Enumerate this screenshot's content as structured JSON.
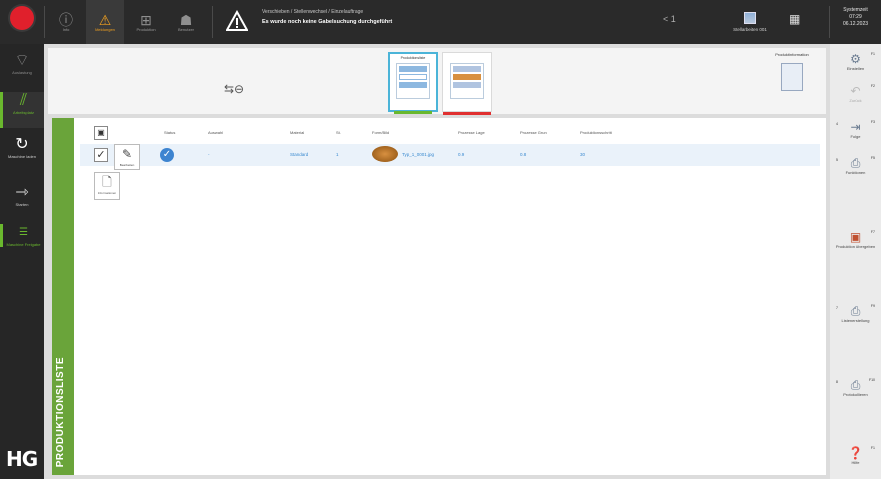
{
  "topbar": {
    "tabs": [
      {
        "icon": "info-icon",
        "label": "Info"
      },
      {
        "icon": "warning-icon",
        "label": "Meldungen"
      },
      {
        "icon": "chart-icon",
        "label": "Produktion"
      },
      {
        "icon": "person-icon",
        "label": "Benutzer"
      }
    ],
    "breadcrumb": "Verschieben / Stellenwechsel / Einzelauftrage",
    "message": "Es wurde noch keine Gabelsuchung durchgeführt",
    "nav_label": "< 1",
    "station_label": "Stellarbeiten 001",
    "clock": {
      "label": "Systemzeit",
      "time": "07:29",
      "date": "06.12.2023"
    }
  },
  "leftbar": {
    "items": [
      {
        "icon": "wifi-icon",
        "label": "Auslastung"
      },
      {
        "icon": "lines-icon",
        "label": "Arbeitsplatz"
      },
      {
        "icon": "refresh-icon",
        "label": "Maschine laden"
      },
      {
        "icon": "arrow-right-icon",
        "label": "Starten"
      },
      {
        "icon": "list-icon",
        "label": "Maschine Freigabe"
      }
    ],
    "logo": "HG"
  },
  "toolbar": {
    "view_prod_label": "Produktionsliste",
    "prod_info_label": "Produktinformation"
  },
  "list": {
    "title": "PRODUKTIONSLISTE",
    "columns": [
      "Status",
      "Auswahl",
      "Material",
      "St.",
      "Form/Bild",
      "Prozesse Lage",
      "Prozesse Grun",
      "Produktionsschritt"
    ],
    "row": {
      "auswahl": "-",
      "material": "Standard",
      "count": "1",
      "form": "Typ_1_0001.jpg",
      "lage": "0.9",
      "grun": "0.8",
      "schritt": "30"
    },
    "edit_label": "Bearbeiten",
    "doc_label": "Informationen"
  },
  "rightbar": {
    "items": [
      {
        "icon": "settings-icon",
        "label": "Einstellen",
        "key": "F1"
      },
      {
        "icon": "undo-icon",
        "label": "Zurück",
        "key": "F2"
      },
      {
        "icon": "arrow-icon",
        "label": "Folge",
        "key": "F3",
        "num": "4"
      },
      {
        "icon": "printer-icon",
        "label": "Funktionen",
        "key": "F5",
        "num": "5"
      },
      {
        "icon": "image-icon",
        "label": "Produktion übergeben",
        "key": "F7"
      },
      {
        "icon": "printer-icon",
        "label": "Listenerstellung",
        "key": "F9",
        "num": "7"
      },
      {
        "icon": "printer-icon",
        "label": "Protokollieren",
        "key": "F10",
        "num": "8"
      },
      {
        "icon": "help-icon",
        "label": "Hilfe",
        "key": "F1"
      }
    ]
  }
}
